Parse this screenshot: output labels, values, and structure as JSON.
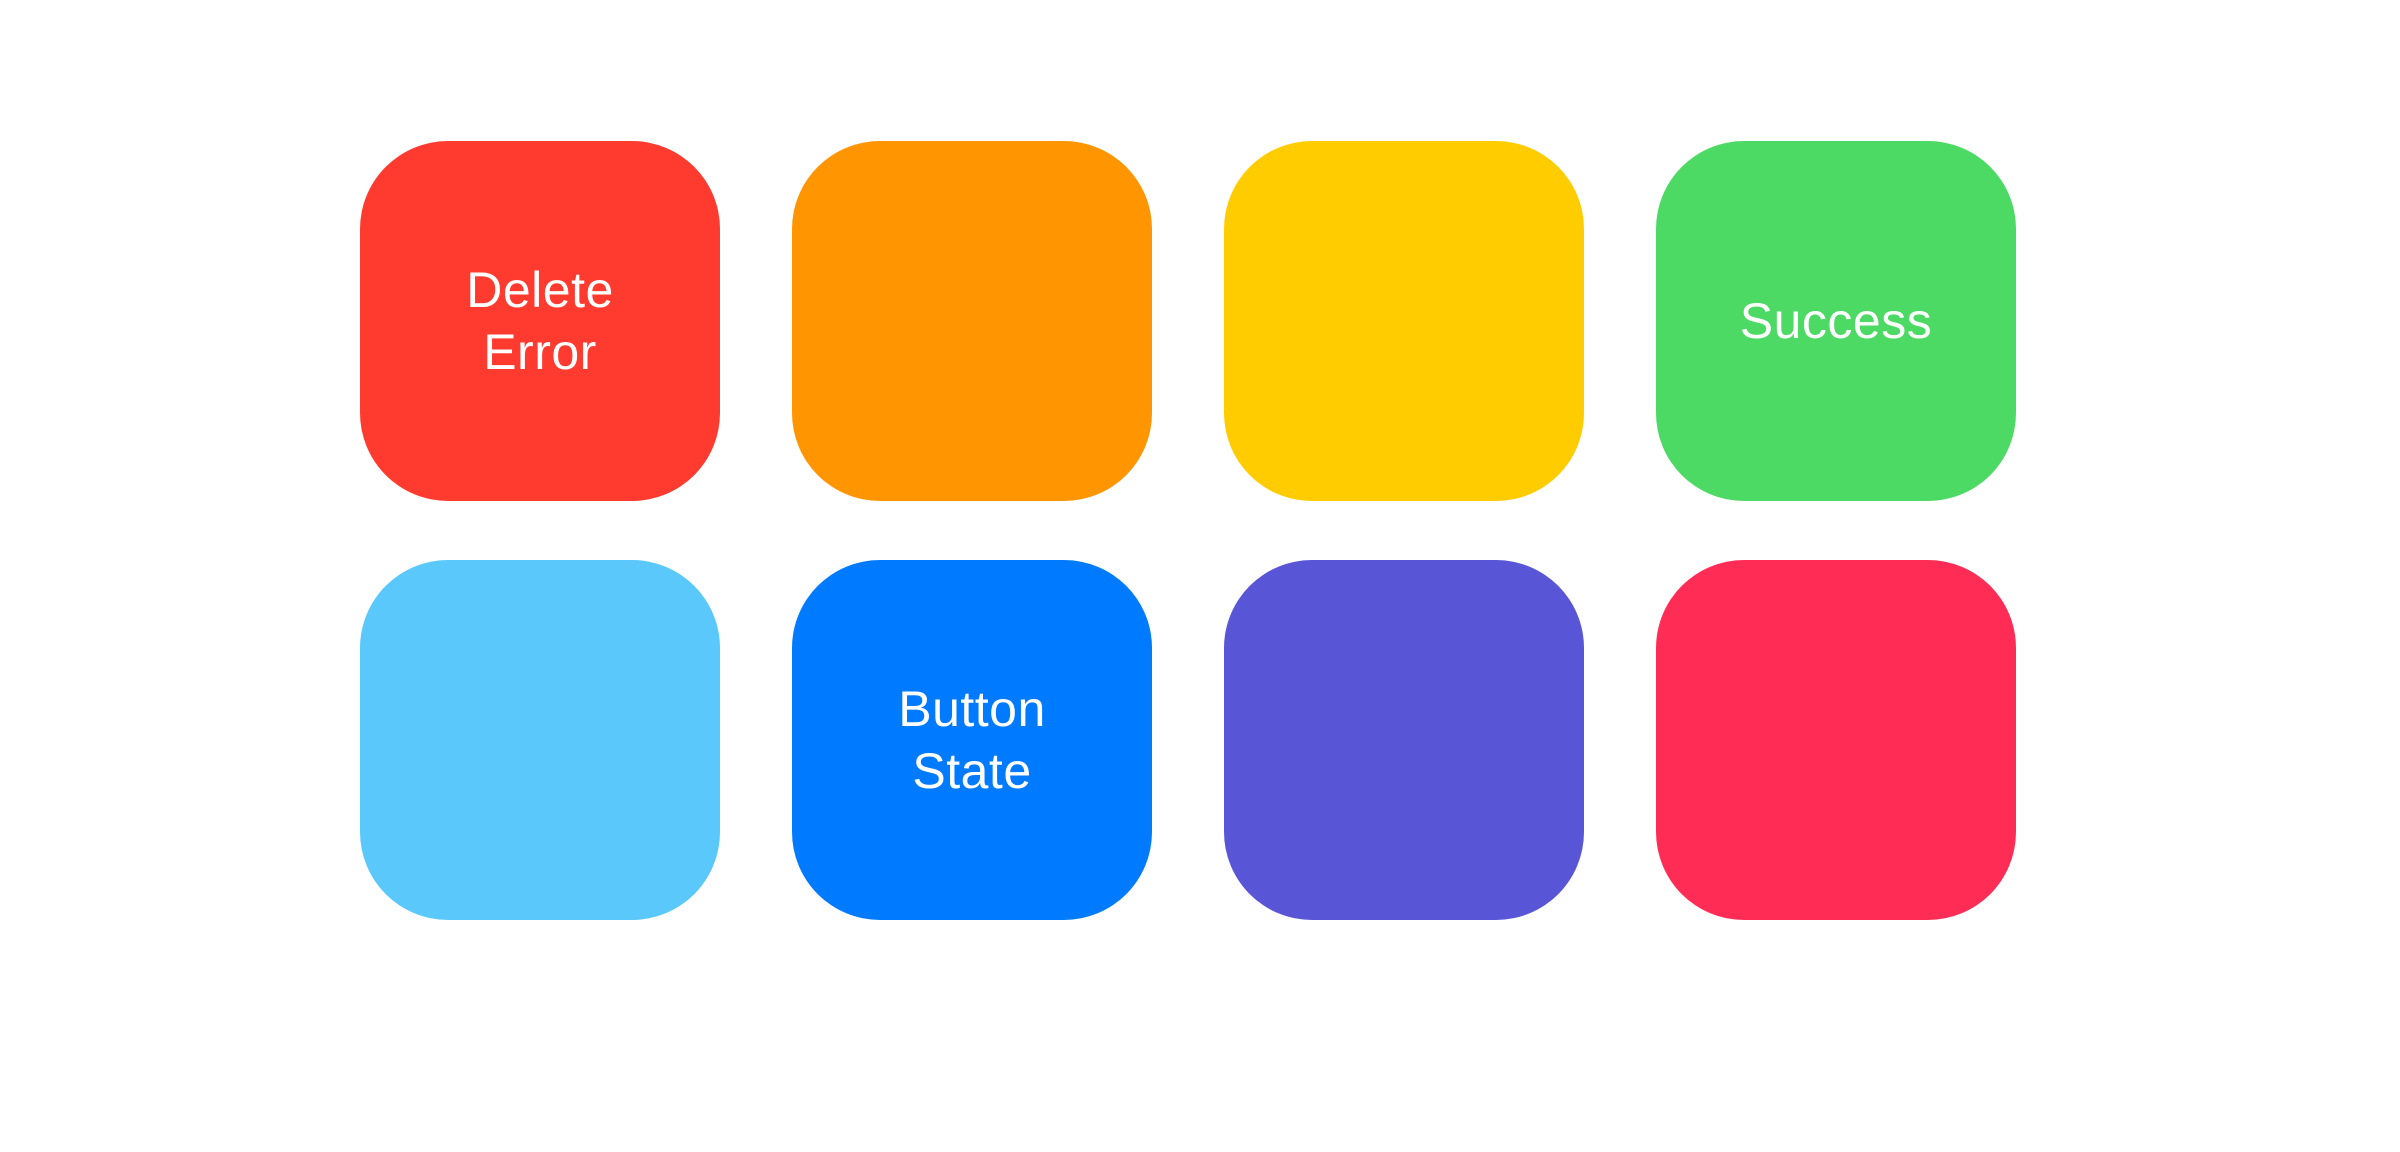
{
  "tiles": [
    {
      "label": "Delete\nError",
      "color": "#FF3B30"
    },
    {
      "label": "",
      "color": "#FF9500"
    },
    {
      "label": "",
      "color": "#FFCC00"
    },
    {
      "label": "Success",
      "color": "#4CD964"
    },
    {
      "label": "",
      "color": "#5AC8FA"
    },
    {
      "label": "Button\nState",
      "color": "#007AFF"
    },
    {
      "label": "",
      "color": "#5856D6"
    },
    {
      "label": "",
      "color": "#FF2D55"
    }
  ]
}
